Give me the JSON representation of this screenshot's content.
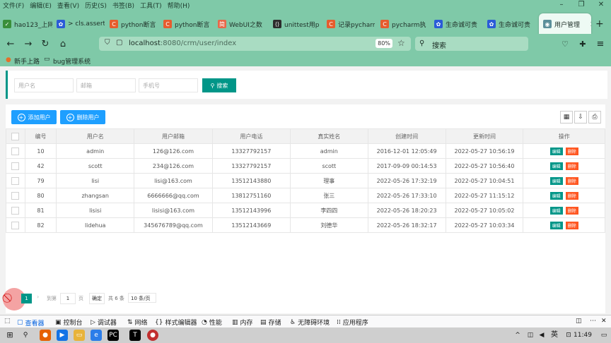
{
  "browser": {
    "menu": [
      "文件(F)",
      "编辑(E)",
      "查看(V)",
      "历史(S)",
      "书签(B)",
      "工具(T)",
      "帮助(H)"
    ],
    "tabs": [
      {
        "label": "hao123_上网",
        "icon": "hao123-icon",
        "color": "#3a8f3a"
      },
      {
        "label": "> cls.assert",
        "icon": "paw-icon",
        "color": "#2a5bd7"
      },
      {
        "label": "python断言",
        "icon": "csdn-c-icon",
        "color": "#e65c2e"
      },
      {
        "label": "python断言",
        "icon": "csdn-c-icon",
        "color": "#e65c2e"
      },
      {
        "label": "WebUI之数",
        "icon": "jianshu-icon",
        "color": "#e8684a"
      },
      {
        "label": "unittest用p",
        "icon": "code-icon",
        "color": "#2c2c2c"
      },
      {
        "label": "记录pycharm",
        "icon": "csdn-c-icon",
        "color": "#e65c2e"
      },
      {
        "label": "pycharm执",
        "icon": "csdn-c-icon",
        "color": "#e65c2e"
      },
      {
        "label": "生命诚可贵",
        "icon": "paw-icon",
        "color": "#2a5bd7"
      },
      {
        "label": "生命诚可贵",
        "icon": "paw-icon",
        "color": "#2a5bd7"
      },
      {
        "label": "用户管理",
        "icon": "page-icon",
        "color": "#5b8f9a",
        "active": true
      }
    ],
    "new_tab": "+",
    "url_host": "localhost",
    "url_rest": ":8080/crm/user/index",
    "zoom": "80%",
    "search_placeholder": "搜索",
    "bookmarks": [
      "新手上路",
      "bug管理系统"
    ]
  },
  "search": {
    "username_placeholder": "用户名",
    "email_placeholder": "邮箱",
    "phone_placeholder": "手机号",
    "button": "搜索"
  },
  "toolbar": {
    "add": "添加用户",
    "delete": "删除用户"
  },
  "table": {
    "headers": [
      "编号",
      "用户名",
      "用户邮箱",
      "用户电话",
      "真实姓名",
      "创建时间",
      "更新时间",
      "操作"
    ],
    "edit_label": "编辑",
    "delete_label": "删除",
    "rows": [
      [
        "10",
        "admin",
        "126@126.com",
        "13327792157",
        "admin",
        "2016-12-01 12:05:49",
        "2022-05-27 10:56:19"
      ],
      [
        "42",
        "scott",
        "234@126.com",
        "13327792157",
        "scott",
        "2017-09-09 00:14:53",
        "2022-05-27 10:56:40"
      ],
      [
        "79",
        "lisi",
        "lisi@163.com",
        "13512143880",
        "理事",
        "2022-05-26 17:32:19",
        "2022-05-27 10:04:51"
      ],
      [
        "80",
        "zhangsan",
        "6666666@qq.com",
        "13812751160",
        "张三",
        "2022-05-26 17:33:10",
        "2022-05-27 11:15:12"
      ],
      [
        "81",
        "lisisi",
        "lisisi@163.com",
        "13512143996",
        "李四四",
        "2022-05-26 18:20:23",
        "2022-05-27 10:05:02"
      ],
      [
        "82",
        "lidehua",
        "345676789@qq.com",
        "13512143669",
        "刘德华",
        "2022-05-26 18:32:17",
        "2022-05-27 10:03:34"
      ]
    ]
  },
  "pager": {
    "current": "1",
    "goto": "到第",
    "page_value": "1",
    "page_suffix": "页",
    "confirm": "确定",
    "total": "共 6 条",
    "per_page": "10 条/页"
  },
  "devtools": {
    "tabs": [
      "查看器",
      "控制台",
      "调试器",
      "网络",
      "样式编辑器",
      "性能",
      "内存",
      "存储",
      "无障碍环境",
      "应用程序"
    ]
  },
  "taskbar": {
    "ime": "英",
    "time": "11:49"
  }
}
